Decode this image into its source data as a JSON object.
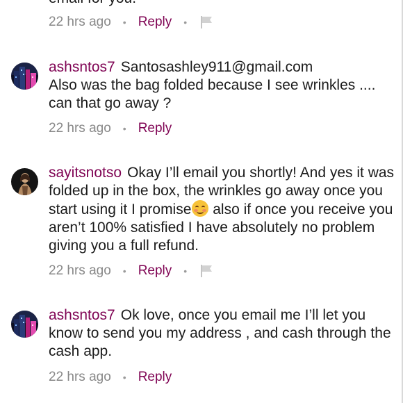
{
  "top_partial": {
    "text_fragment": "email for you.",
    "time": "22 hrs ago",
    "reply_label": "Reply",
    "bullet": "•",
    "has_flag": true
  },
  "comments": [
    {
      "username": "ashsntos7",
      "text": "Santosashley911@gmail.com\nAlso was the bag folded because I see wrinkles .... can that go away ?",
      "text_first": "Santosashley911@gmail.com",
      "text_rest": "Also was the bag folded because I see wrinkles .... can that go away ?",
      "time": "22 hrs ago",
      "reply_label": "Reply",
      "bullet": "•",
      "has_flag": false,
      "avatar": "city-night-avatar"
    },
    {
      "username": "sayitsnotso",
      "text_before_emoji": "Okay I’ll email you shortly! And yes it was folded up in the box, the wrinkles go away once you start using it I promise",
      "emoji": "smiling-face-icon",
      "text_after_emoji": " also if once you receive you aren’t 100% satisfied I have absolutely no problem giving you a full refund.",
      "time": "22 hrs ago",
      "reply_label": "Reply",
      "bullet": "•",
      "has_flag": true,
      "avatar": "person-portrait-avatar"
    },
    {
      "username": "ashsntos7",
      "text": "Ok love, once you email me I’ll let you know to send you my address , and cash through the cash app.",
      "time": "22 hrs ago",
      "reply_label": "Reply",
      "bullet": "•",
      "has_flag": false,
      "avatar": "city-night-avatar"
    }
  ],
  "colors": {
    "username": "#7f0353",
    "reply": "#7f0353",
    "timestamp": "#888888",
    "body_text": "#1b1b1b"
  }
}
